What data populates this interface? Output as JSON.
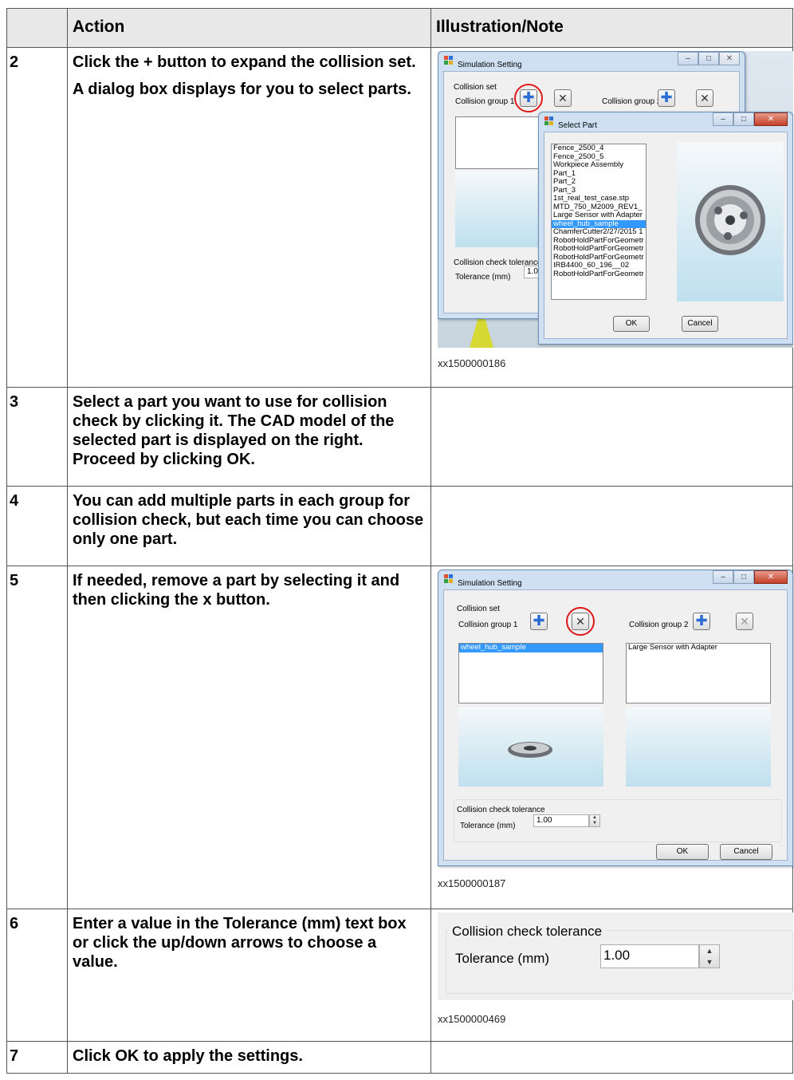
{
  "table": {
    "header": {
      "col1": "",
      "col2": "Action",
      "col3": "Illustration/Note"
    },
    "rows": [
      {
        "num": "2",
        "action_line1_pre": "Click the ",
        "action_line1_bold": "+",
        "action_line1_post": " button to expand the collision set.",
        "action_line2": "A dialog box displays for you to select parts.",
        "ref": "xx1500000186"
      },
      {
        "num": "3",
        "action_pre": "Select a part you want to use for collision check by clicking it. The CAD model of the selected part is displayed on the right. Proceed by clicking ",
        "action_bold": "OK",
        "action_post": "."
      },
      {
        "num": "4",
        "action": "You can add multiple parts in each group for collision check, but each time you can choose only one part."
      },
      {
        "num": "5",
        "action_pre": "If needed, remove a part by selecting it and then clicking the ",
        "action_bold": "x",
        "action_post": " button.",
        "ref": "xx1500000187"
      },
      {
        "num": "6",
        "action_pre": "Enter a value in the ",
        "action_bold": "Tolerance (mm)",
        "action_post": " text box or click the up/down arrows to choose a value.",
        "ref": "xx1500000469"
      },
      {
        "num": "7",
        "action_pre": "Click ",
        "action_bold": "OK",
        "action_post": " to apply the settings."
      }
    ]
  },
  "shot1": {
    "sim_title": "Simulation Setting",
    "collision_set": "Collision set",
    "group1": "Collision group 1",
    "group2": "Collision group 2",
    "tolerance_group": "Collision check tolerance",
    "tolerance_label": "Tolerance (mm)",
    "tolerance_value": "1.0",
    "select_title": "Select Part",
    "parts": [
      "Fence_2500_4",
      "Fence_2500_5",
      "Workpiece Assembly",
      "Part_1",
      "Part_2",
      "Part_3",
      "1st_real_test_case.stp",
      "MTD_750_M2009_REV1_",
      "Large Sensor with Adapter",
      "wheel_hub_sample",
      "ChamferCutter2/27/2015 1",
      "RobotHoldPartForGeometr",
      "RobotHoldPartForGeometr",
      "RobotHoldPartForGeometr",
      "IRB4400_60_196__02",
      "RobotHoldPartForGeometr"
    ],
    "selected_part": "wheel_hub_sample",
    "ok": "OK",
    "cancel": "Cancel"
  },
  "shot2": {
    "title": "Simulation Setting",
    "collision_set": "Collision set",
    "group1": "Collision group 1",
    "group2": "Collision group 2",
    "group1_item": "wheel_hub_sample",
    "group2_item": "Large Sensor with Adapter",
    "tolerance_group": "Collision check tolerance",
    "tolerance_label": "Tolerance (mm)",
    "tolerance_value": "1.00",
    "ok": "OK",
    "cancel": "Cancel"
  },
  "shot3": {
    "tolerance_group": "Collision check tolerance",
    "tolerance_label": "Tolerance (mm)",
    "tolerance_value": "1.00"
  },
  "colors": {
    "header_bg": "#e8e8e8",
    "selection": "#3399ff",
    "highlight_circle": "#e01818",
    "title_bar": "#cfe0f2"
  }
}
